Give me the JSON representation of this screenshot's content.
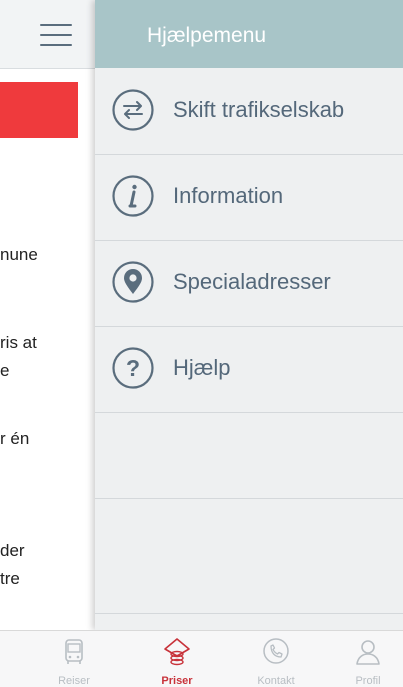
{
  "background": {
    "text_lines": [
      "nune",
      "ris at",
      "e",
      "r én",
      "der",
      "tre"
    ]
  },
  "menu": {
    "title": "Hjælpemenu",
    "items": [
      {
        "label": "Skift trafikselskab",
        "icon": "swap-arrows-icon"
      },
      {
        "label": "Information",
        "icon": "info-icon"
      },
      {
        "label": "Specialadresser",
        "icon": "location-pin-icon"
      },
      {
        "label": "Hjælp",
        "icon": "question-icon"
      }
    ]
  },
  "tabbar": {
    "tabs": [
      {
        "label": "Reiser",
        "icon": "bus-icon",
        "active": false
      },
      {
        "label": "Priser",
        "icon": "price-tag-icon",
        "active": true
      },
      {
        "label": "Kontakt",
        "icon": "phone-icon",
        "active": false
      },
      {
        "label": "Profil",
        "icon": "person-icon",
        "active": false
      }
    ]
  },
  "colors": {
    "menu_header": "#a8c5c8",
    "menu_text": "#54687a",
    "active_tab": "#c8323a",
    "banner_red": "#ef3a3d"
  }
}
